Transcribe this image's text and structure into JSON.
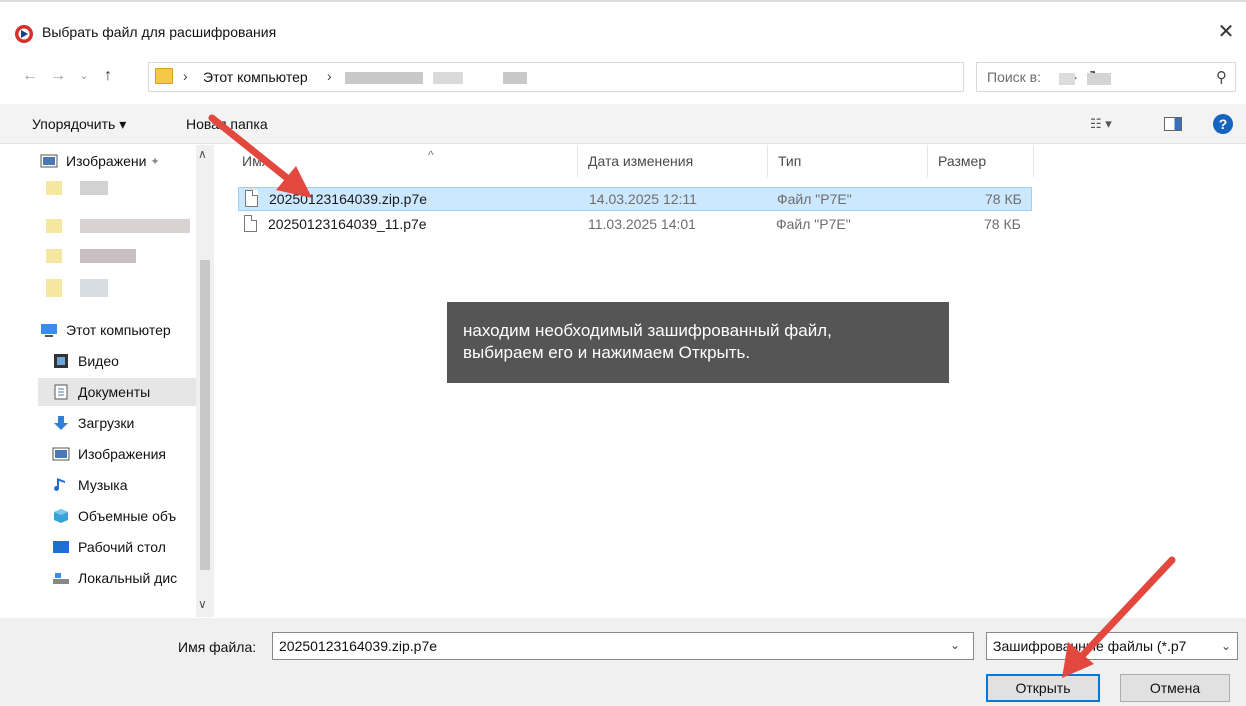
{
  "window": {
    "title": "Выбрать файл для расшифрования",
    "close_glyph": "✕",
    "icon": "app-logo-icon"
  },
  "address": {
    "breadcrumb": "Этот компьютер",
    "search_placeholder": "Поиск в:"
  },
  "toolbar": {
    "organize_label": "Упорядочить ▾",
    "new_folder_label": "Новая папка"
  },
  "sidebar": {
    "items": [
      {
        "label": "Изображени",
        "icon": "pictures-icon",
        "pinned": true
      },
      {
        "label": "Этот компьютер",
        "icon": "computer-icon"
      },
      {
        "label": "Видео",
        "icon": "video-icon"
      },
      {
        "label": "Документы",
        "icon": "documents-icon",
        "selected": true
      },
      {
        "label": "Загрузки",
        "icon": "downloads-icon"
      },
      {
        "label": "Изображения",
        "icon": "pictures-icon"
      },
      {
        "label": "Музыка",
        "icon": "music-icon"
      },
      {
        "label": "Объемные объ",
        "icon": "3d-objects-icon"
      },
      {
        "label": "Рабочий стол",
        "icon": "desktop-icon"
      },
      {
        "label": "Локальный дис",
        "icon": "local-disk-icon"
      }
    ]
  },
  "filelist": {
    "columns": [
      "Имя",
      "Дата изменения",
      "Тип",
      "Размер"
    ],
    "rows": [
      {
        "name": "20250123164039.zip.p7e",
        "date": "14.03.2025 12:11",
        "type": "Файл \"P7E\"",
        "size": "78 КБ",
        "selected": true
      },
      {
        "name": "20250123164039_11.p7e",
        "date": "11.03.2025 14:01",
        "type": "Файл \"P7E\"",
        "size": "78 КБ",
        "selected": false
      }
    ]
  },
  "callout": {
    "line1": "находим необходимый зашифрованный файл,",
    "line2": "выбираем его и нажимаем Открыть."
  },
  "footer": {
    "filename_label": "Имя файла:",
    "filename_value": "20250123164039.zip.p7e",
    "filetype_value": "Зашифрованные файлы (*.p7",
    "open_label": "Открыть",
    "cancel_label": "Отмена"
  },
  "colors": {
    "selection": "#cce8ff",
    "accent": "#0078d7",
    "arrow": "#e2483d",
    "callout_bg": "#555555"
  }
}
